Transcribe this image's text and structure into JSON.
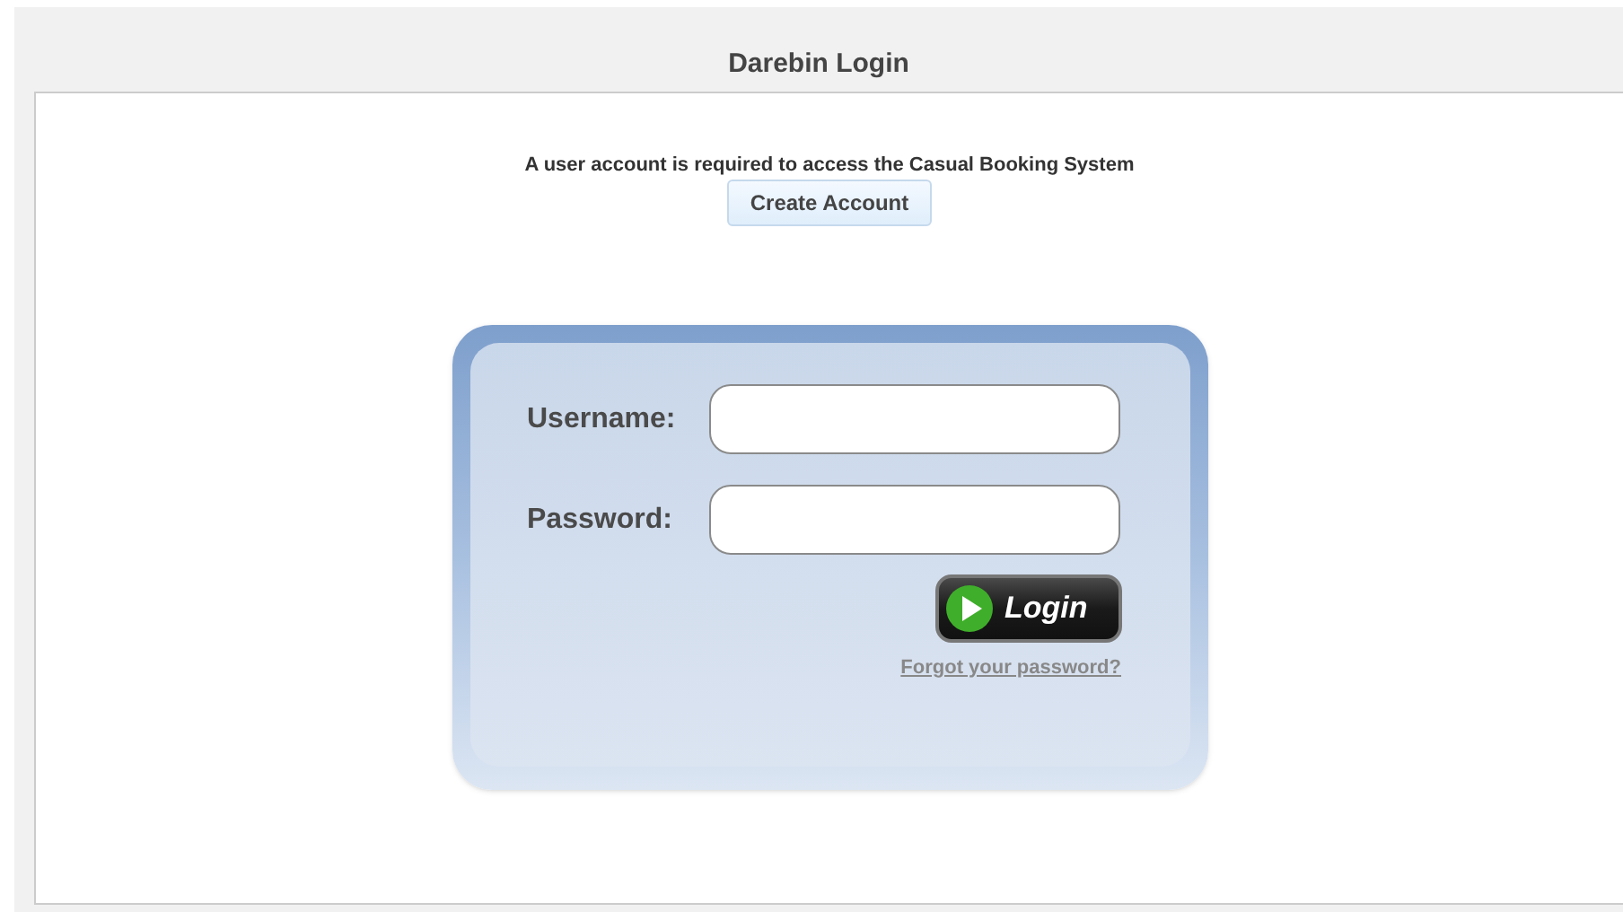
{
  "title": "Darebin Login",
  "notice": "A user account is required to access the Casual Booking System",
  "create_account": "Create Account",
  "fields": [
    {
      "label": "Username:"
    },
    {
      "label": "Password:"
    }
  ],
  "login_button": "Login",
  "forgot_link": "Forgot your password?"
}
